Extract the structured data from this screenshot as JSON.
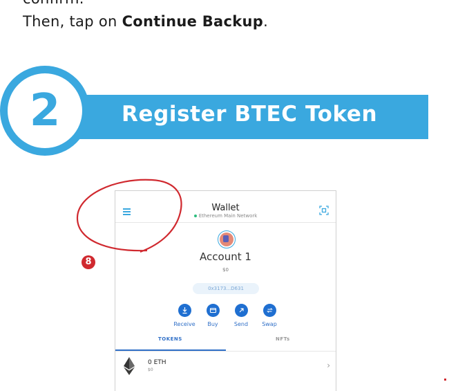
{
  "top": {
    "line1": "confirm.",
    "line2_prefix": "Then, tap on ",
    "line2_bold": "Continue Backup",
    "line2_suffix": "."
  },
  "step": {
    "number": "2",
    "title": "Register BTEC Token"
  },
  "phone": {
    "title": "Wallet",
    "network": "Ethereum Main Network",
    "account_name": "Account 1",
    "balance": "$0",
    "address": "0x3173...D631",
    "actions": [
      {
        "label": "Receive",
        "icon": "download-icon"
      },
      {
        "label": "Buy",
        "icon": "card-icon"
      },
      {
        "label": "Send",
        "icon": "arrow-up-right-icon"
      },
      {
        "label": "Swap",
        "icon": "swap-icon"
      }
    ],
    "tabs": {
      "tokens": "TOKENS",
      "nfts": "NFTs"
    },
    "token": {
      "amount": "0 ETH",
      "usd": "$0"
    }
  },
  "annotation": {
    "badge": "8",
    "color": "#d0292f"
  },
  "colors": {
    "accent": "#3aa8df",
    "action_blue": "#1f6fd1"
  }
}
